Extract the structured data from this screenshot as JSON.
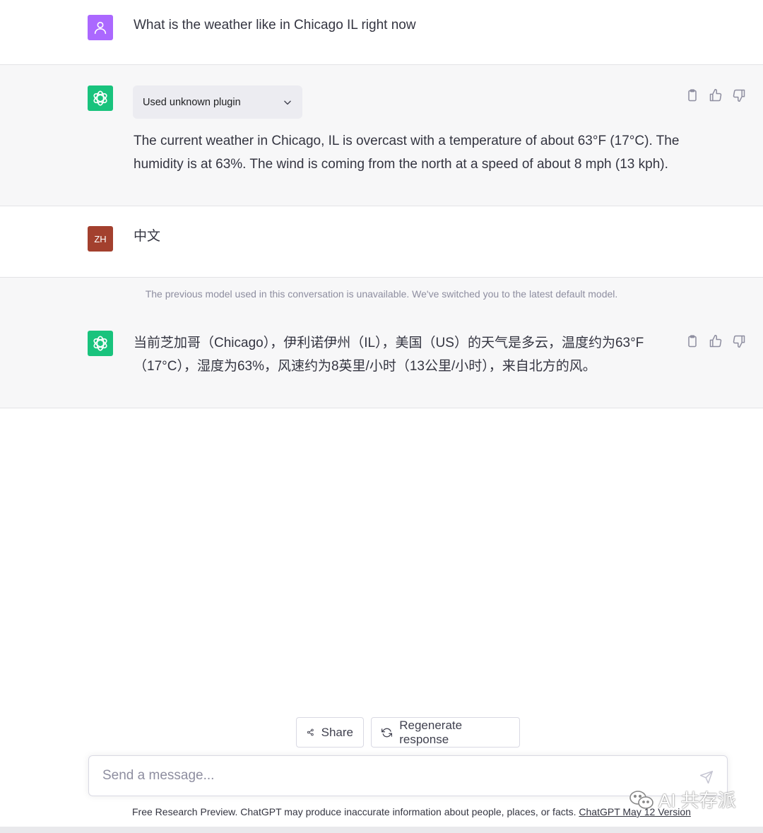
{
  "conversation": {
    "user_message_1": "What is the weather like in Chicago IL right now",
    "plugin_label": "Used unknown plugin",
    "assistant_line_1a": "The current weather in Chicago, IL is overcast with a temperature of about 63°F (17°C). The",
    "assistant_line_1b": "humidity is at 63%. The wind is coming from the north at a speed of about 8 mph (13 kph).",
    "user_initials": "ZH",
    "user_message_2": "中文",
    "model_notice": "The previous model used in this conversation is unavailable. We've switched you to the latest default model.",
    "assistant_line_2a": "当前芝加哥（Chicago），伊利诺伊州（IL），美国（US）的天气是多云，温度约为63°F",
    "assistant_line_2b": "（17°C），湿度为63%，风速约为8英里/小时（13公里/小时），来自北方的风。"
  },
  "actions": {
    "share_label": "Share",
    "regenerate_label": "Regenerate response"
  },
  "composer": {
    "placeholder": "Send a message..."
  },
  "footer": {
    "text": "Free Research Preview. ChatGPT may produce inaccurate information about people, places, or facts. ",
    "link_text": "ChatGPT May 12 Version"
  },
  "watermark": {
    "text": "AI 共存派"
  },
  "colors": {
    "user_avatar": "#ab68ff",
    "assistant_avatar": "#19c37d",
    "zh_avatar": "#a3402e",
    "assistant_row_bg": "#f7f7f8"
  }
}
